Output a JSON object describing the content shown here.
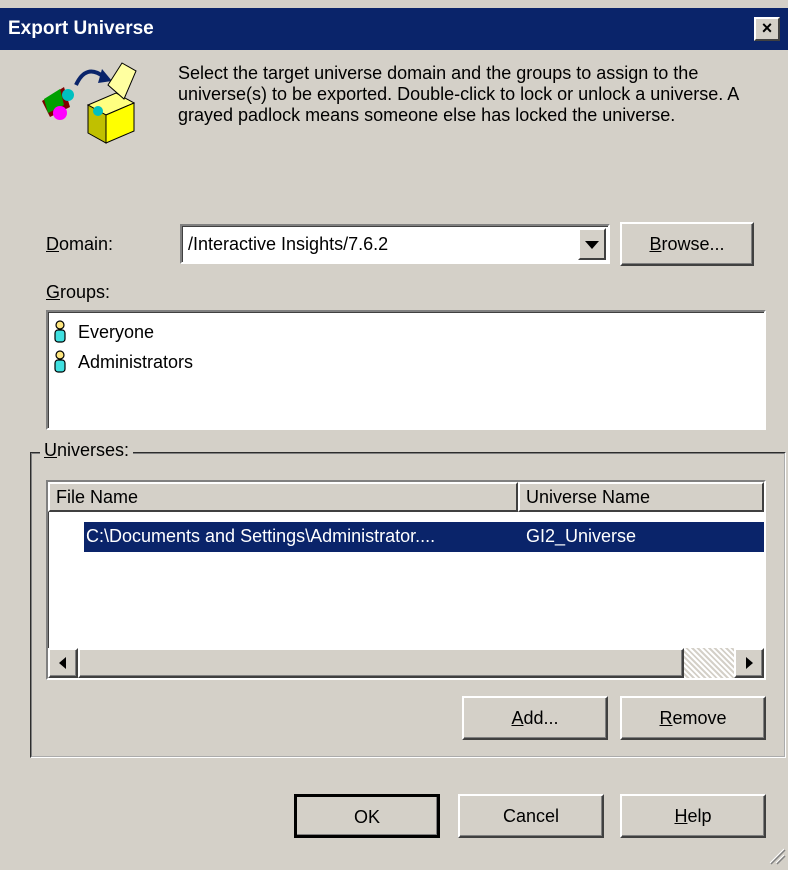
{
  "window": {
    "title": "Export Universe",
    "close_label": "×"
  },
  "description": "Select the target universe domain and the groups to assign to the universe(s) to be exported. Double-click to lock or unlock a universe. A grayed padlock means someone else has locked the universe.",
  "domain": {
    "label_first": "D",
    "label_rest": "omain:",
    "value": "/Interactive Insights/7.6.2",
    "browse_first": "B",
    "browse_rest": "rowse..."
  },
  "groups": {
    "label_first": "G",
    "label_rest": "roups:",
    "items": [
      "Everyone",
      "Administrators"
    ]
  },
  "universes": {
    "label_first": "U",
    "label_rest": "niverses:",
    "columns": [
      "File Name",
      "Universe Name"
    ],
    "rows": [
      {
        "file": "C:\\Documents and Settings\\Administrator....",
        "name": "GI2_Universe",
        "selected": true
      }
    ],
    "add_first": "A",
    "add_rest": "dd...",
    "remove_first": "R",
    "remove_rest": "emove"
  },
  "buttons": {
    "ok": "OK",
    "cancel": "Cancel",
    "help_first": "H",
    "help_rest": "elp"
  },
  "colors": {
    "titlebar": "#0a246a",
    "face": "#d4d0c8",
    "selection": "#0a246a"
  },
  "icons": [
    "export-universe-icon",
    "group-person-icon",
    "dropdown-arrow-icon",
    "scroll-left-icon",
    "scroll-right-icon",
    "resize-grip-icon"
  ]
}
